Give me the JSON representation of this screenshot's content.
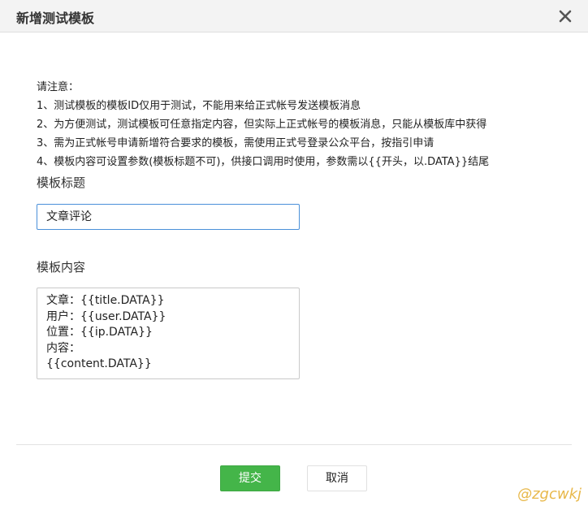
{
  "dialog": {
    "title": "新增测试模板"
  },
  "notes": {
    "heading": "请注意：",
    "items": [
      "1、测试模板的模板ID仅用于测试，不能用来给正式帐号发送模板消息",
      "2、为方便测试，测试模板可任意指定内容，但实际上正式帐号的模板消息，只能从模板库中获得",
      "3、需为正式帐号申请新增符合要求的模板，需使用正式号登录公众平台，按指引申请",
      "4、模板内容可设置参数(模板标题不可)，供接口调用时使用，参数需以{{开头，以.DATA}}结尾"
    ]
  },
  "form": {
    "title_label": "模板标题",
    "title_value": "文章评论",
    "content_label": "模板内容",
    "content_value": "文章：{{title.DATA}}\n用户：{{user.DATA}}\n位置：{{ip.DATA}}\n内容：\n{{content.DATA}}"
  },
  "buttons": {
    "submit_label": "提交",
    "cancel_label": "取消"
  },
  "watermark": "@zgcwkj",
  "colors": {
    "submit_bg": "#44b549",
    "input_focus_border": "#4a90d9",
    "titlebar_bg": "#f3f3f3"
  }
}
